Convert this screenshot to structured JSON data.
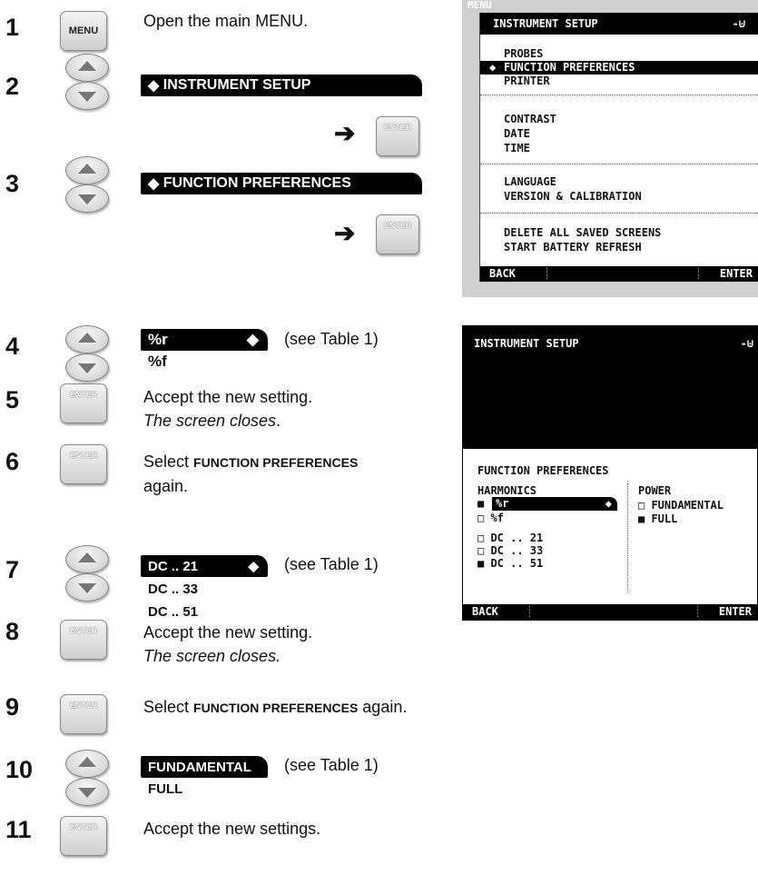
{
  "steps": [
    {
      "n": "1"
    },
    {
      "n": "2"
    },
    {
      "n": "3"
    },
    {
      "n": "4"
    },
    {
      "n": "5"
    },
    {
      "n": "6"
    },
    {
      "n": "7"
    },
    {
      "n": "8"
    },
    {
      "n": "9"
    },
    {
      "n": "10"
    },
    {
      "n": "11"
    }
  ],
  "keys": {
    "menu": "MENU",
    "enter": "ENTER"
  },
  "text": {
    "s1": "Open the main",
    "s1_sc": "MENU",
    "s1_end": ".",
    "s2_bar": "INSTRUMENT SETUP",
    "s3_bar": "FUNCTION PREFERENCES",
    "s4_bar": "%r",
    "s4_sub": "%f",
    "see": "(see Table 1)",
    "s5_a": "Accept the new setting.",
    "s5_b": "The screen closes",
    "s5_b_end": ".",
    "s6_a": "Select",
    "s6_bold": "FUNCTION PREFERENCES",
    "s6_b": "again.",
    "s7_bar": "DC .. 21",
    "s7_sub1": "DC .. 33",
    "s7_sub2": "DC .. 51",
    "s8_a": "Accept the new setting.",
    "s8_b": "The screen closes.",
    "s9_a": "Select",
    "s9_bold": "FUNCTION PREFERENCES",
    "s9_b": "again.",
    "s10_bar": "FUNDAMENTAL",
    "s10_sub": "FULL",
    "s11": "Accept the new settings."
  },
  "screen1": {
    "behind": "MENU",
    "title": "INSTRUMENT SETUP",
    "items": [
      "PROBES",
      "FUNCTION PREFERENCES",
      "PRINTER",
      "CONTRAST",
      "DATE",
      "TIME",
      "LANGUAGE",
      "VERSION & CALIBRATION",
      "DELETE ALL SAVED SCREENS",
      "START BATTERY REFRESH"
    ],
    "foot_left": "BACK",
    "foot_right": "ENTER"
  },
  "screen2": {
    "title": "INSTRUMENT SETUP",
    "section": "FUNCTION PREFERENCES",
    "col1": "HARMONICS",
    "col2": "POWER",
    "h1": "%r",
    "h2": "%f",
    "h3": "DC .. 21",
    "h4": "DC .. 33",
    "h5": "DC .. 51",
    "p1": "FUNDAMENTAL",
    "p2": "FULL",
    "foot_left": "BACK",
    "foot_right": "ENTER"
  }
}
